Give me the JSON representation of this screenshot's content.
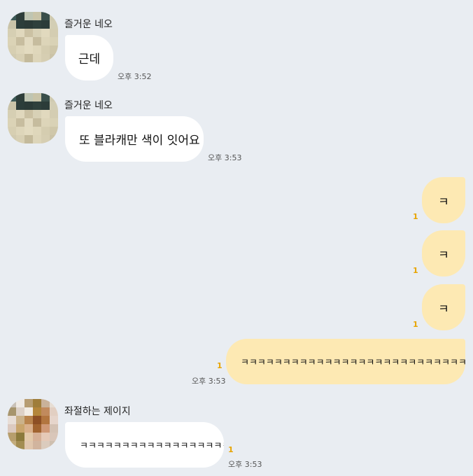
{
  "messages": [
    {
      "sender": "즐거운 네오",
      "text": "근데",
      "time": "오후 3:52"
    },
    {
      "sender": "즐거운 네오",
      "text": "또 블라캐만 색이 잇어요",
      "time": "오후 3:53"
    },
    {
      "text": "ㅋ",
      "unread": "1"
    },
    {
      "text": "ㅋ",
      "unread": "1"
    },
    {
      "text": "ㅋ",
      "unread": "1"
    },
    {
      "text": "ㅋㅋㅋㅋㅋㅋㅋㅋㅋㅋㅋㅋㅋㅋㅋㅋㅋㅋㅋㅋㅋㅋㅋㅋㅋㅋㅋ시이발;;;;",
      "unread": "1",
      "time": "오후 3:53"
    },
    {
      "sender": "좌절하는 제이지",
      "text": "ㅋㅋㅋㅋㅋㅋㅋㅋㅋㅋㅋㅋㅋㅋㅋㅋㅋㅋㅋㅋㅋ",
      "unread": "1",
      "time": "오후 3:53"
    }
  ],
  "colors": {
    "background": "#e9edf2",
    "incoming_bubble": "#ffffff",
    "outgoing_bubble": "#fde9b3",
    "unread": "#e7a400"
  }
}
